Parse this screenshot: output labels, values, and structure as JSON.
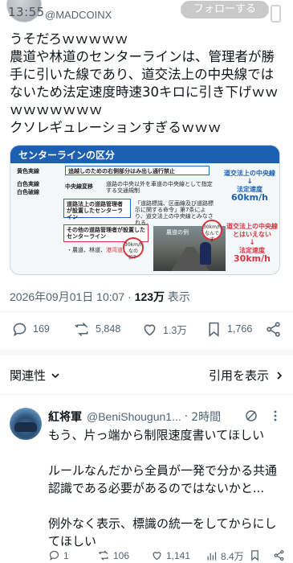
{
  "status_bar": {
    "time": "13:55"
  },
  "author": {
    "handle": "@MADCOINX",
    "follow_label": "フォローする"
  },
  "tweet": {
    "text": "うそだろｗｗｗｗｗ\n農道や林道のセンターラインは、管理者が勝手に引いた線であり、道交法上の中央線ではないため法定速度時速30キロに引き下げｗｗｗｗｗｗｗｗｗ\nクソレギュレーションすぎるｗｗｗ",
    "timestamp": "2026年09月01日 10:07",
    "views_count": "123万",
    "views_label": "表示"
  },
  "infographic": {
    "title": "センターラインの区分",
    "label_yellow": "黄色実線",
    "desc_yellow": "追越しのための右側部分はみ出し通行禁止",
    "label_white_solid": "白色実線",
    "label_white_dashed": "白色破線",
    "label_center_change": "中央線変移",
    "desc_center_change": "道路の中央以外を車道の中央線として指定する交通規制",
    "label_road_manager": "道路法上の道路管理者が設置したセンターライン",
    "desc_road_manager": "「道路標識、区画線及び道路標示に関する命令」第7条により、道交法上の中央線とみなされる。",
    "label_other": "その他の道路管理者が設置したセンターライン",
    "desc_other_prefix": "・農道、林道、",
    "desc_other_red": "港湾道路",
    "desc_other_suffix": "等",
    "speed_top_title": "道交法上の中央線",
    "speed_top_label": "法定速度",
    "speed_top_value": "60km/h",
    "speed_bottom_title": "道交法上の中央線とはいえない",
    "speed_bottom_label": "法定速度",
    "speed_bottom_value": "30km/h",
    "photo_caption": "農道の例",
    "badge_left": "30km/h なのに？",
    "badge_right": "30km/h なんです"
  },
  "actions": {
    "replies": "169",
    "retweets": "5,848",
    "likes": "1.3万",
    "bookmarks": "1,766"
  },
  "related": {
    "left_label": "関連性",
    "right_label": "引用を表示"
  },
  "reply": {
    "name": "紅将軍",
    "handle": "@BeniShougun1...",
    "separator": "·",
    "time": "2時間",
    "text": "もう、片っ端から制限速度書いてほしい\n\nルールなんだから全員が一発で分かる共通認識である必要があるのではないかと...\n\n例外なく表示、標識の統一をしてからにしてほしい",
    "replies": "1",
    "retweets": "106",
    "likes": "1,141",
    "views": "8.4万"
  },
  "colors": {
    "accent_blue": "#1d5fb0",
    "warning_red": "#d8343d",
    "muted_text": "#536471"
  }
}
